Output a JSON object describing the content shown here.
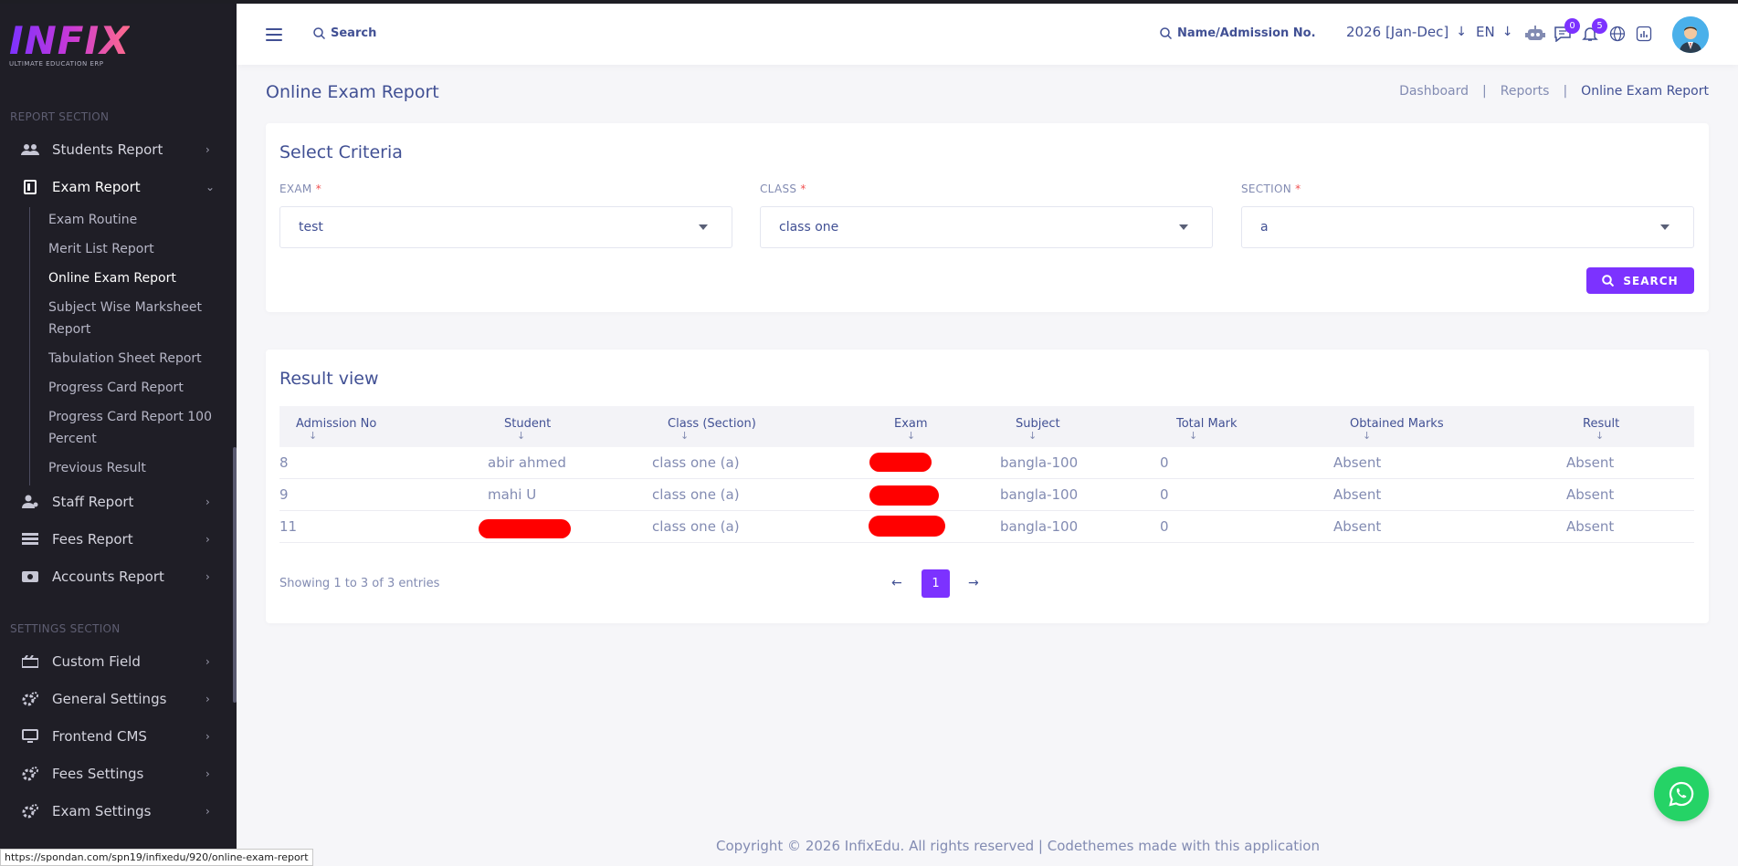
{
  "app": {
    "logo_text": "INFIX",
    "logo_tagline": "ULTIMATE EDUCATION ERP",
    "accent_color": "#7c32ff"
  },
  "sidebar": {
    "report_section_title": "REPORT SECTION",
    "settings_section_title": "SETTINGS SECTION",
    "items": [
      {
        "label": "Students Report",
        "icon": "students-icon"
      },
      {
        "label": "Exam Report",
        "icon": "exam-report-icon"
      },
      {
        "label": "Staff Report",
        "icon": "staff-icon"
      },
      {
        "label": "Fees Report",
        "icon": "fees-icon"
      },
      {
        "label": "Accounts Report",
        "icon": "accounts-icon"
      }
    ],
    "exam_report_sub": [
      "Exam Routine",
      "Merit List Report",
      "Online Exam Report",
      "Subject Wise Marksheet",
      "Report",
      "Tabulation Sheet Report",
      "Progress Card Report",
      "Progress Card Report 100",
      "Percent",
      "Previous Result"
    ],
    "settings_items": [
      {
        "label": "Custom Field",
        "icon": "custom-field-icon"
      },
      {
        "label": "General Settings",
        "icon": "gear-icon"
      },
      {
        "label": "Frontend CMS",
        "icon": "monitor-icon"
      },
      {
        "label": "Fees Settings",
        "icon": "gear-icon"
      },
      {
        "label": "Exam Settings",
        "icon": "gear-icon"
      }
    ]
  },
  "header": {
    "search_label": "Search",
    "name_search_label": "Name/Admission No.",
    "year": "2026 [Jan-Dec]",
    "lang": "EN",
    "chat_badge": "0",
    "notif_badge": "5"
  },
  "page": {
    "title": "Online Exam Report",
    "breadcrumb": [
      "Dashboard",
      "Reports",
      "Online Exam Report"
    ]
  },
  "criteria": {
    "title": "Select Criteria",
    "exam_label": "EXAM",
    "exam_value": "test",
    "class_label": "CLASS",
    "class_value": "class one",
    "section_label": "SECTION",
    "section_value": "a",
    "required_mark": "*",
    "search_button": "SEARCH"
  },
  "results": {
    "title": "Result view",
    "columns": [
      "Admission No",
      "Student",
      "Class (Section)",
      "Exam",
      "Subject",
      "Total Mark",
      "Obtained Marks",
      "Result"
    ],
    "rows": [
      {
        "admission": "8",
        "student": "abir ahmed",
        "class": "class one (a)",
        "exam": "",
        "subject": "bangla-100",
        "total": "0",
        "obtained": "Absent",
        "result": "Absent"
      },
      {
        "admission": "9",
        "student": "mahi U",
        "class": "class one (a)",
        "exam": "",
        "subject": "bangla-100",
        "total": "0",
        "obtained": "Absent",
        "result": "Absent"
      },
      {
        "admission": "11",
        "student": "",
        "class": "class one (a)",
        "exam": "",
        "subject": "bangla-100",
        "total": "0",
        "obtained": "Absent",
        "result": "Absent"
      }
    ],
    "showing": "Showing 1 to 3 of 3 entries",
    "current_page": "1"
  },
  "footer": {
    "text": "Copyright © 2026 InfixEdu. All rights reserved | Codethemes made with this application"
  },
  "status_url": "https://spondan.com/spn19/infixedu/920/online-exam-report"
}
